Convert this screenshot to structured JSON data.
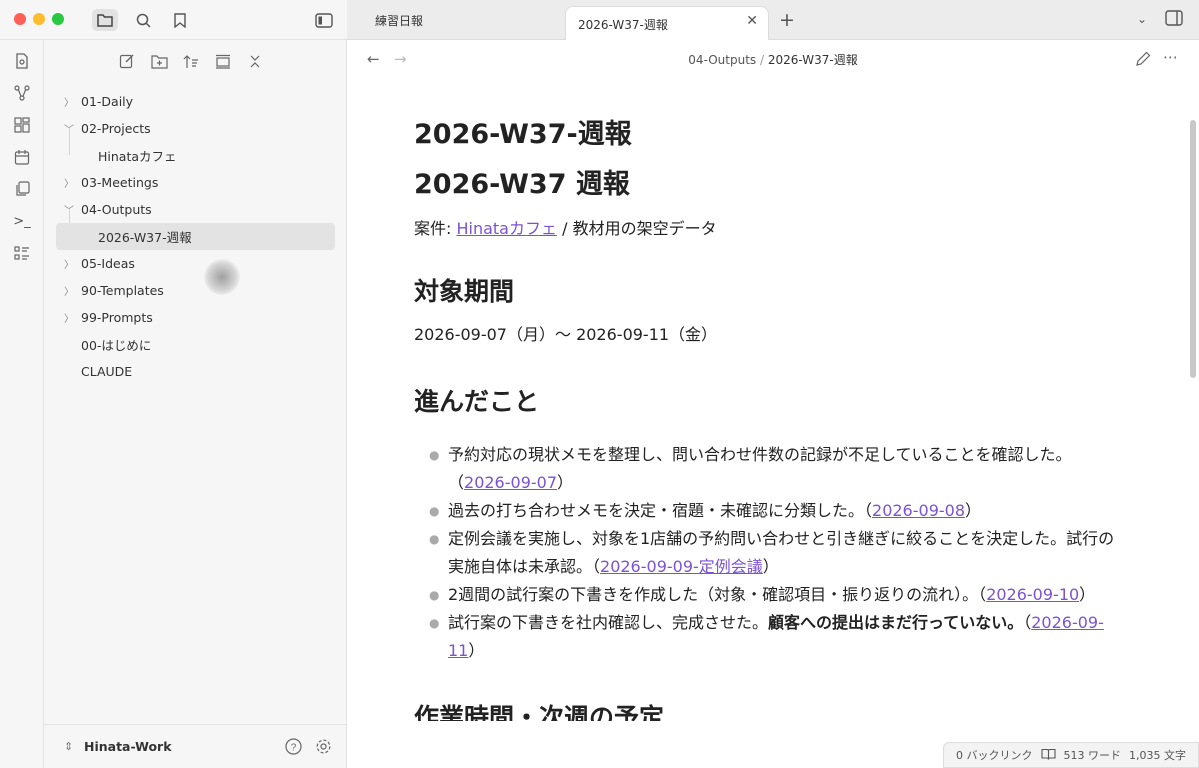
{
  "window": {
    "traffic_lights": [
      "#ff5f57",
      "#febc2e",
      "#28c840"
    ]
  },
  "tabs": [
    {
      "label": "練習日報",
      "active": false
    },
    {
      "label": "2026-W37-週報",
      "active": true
    }
  ],
  "sidebar": {
    "tree": [
      {
        "label": "01-Daily",
        "type": "folder",
        "expanded": false
      },
      {
        "label": "02-Projects",
        "type": "folder",
        "expanded": true
      },
      {
        "label": "Hinataカフェ",
        "type": "file",
        "child": true
      },
      {
        "label": "03-Meetings",
        "type": "folder",
        "expanded": false
      },
      {
        "label": "04-Outputs",
        "type": "folder",
        "expanded": true
      },
      {
        "label": "2026-W37-週報",
        "type": "file",
        "child": true,
        "selected": true
      },
      {
        "label": "05-Ideas",
        "type": "folder",
        "expanded": false
      },
      {
        "label": "90-Templates",
        "type": "folder",
        "expanded": false
      },
      {
        "label": "99-Prompts",
        "type": "folder",
        "expanded": false
      },
      {
        "label": "00-はじめに",
        "type": "file"
      },
      {
        "label": "CLAUDE",
        "type": "file"
      }
    ],
    "vault_name": "Hinata-Work"
  },
  "breadcrumb": {
    "folder": "04-Outputs",
    "separator": " / ",
    "file": "2026-W37-週報"
  },
  "doc": {
    "title": "2026-W37-週報",
    "h1": "2026-W37 週報",
    "project_prefix": "案件: ",
    "project_link": "Hinataカフェ",
    "project_suffix": " / 教材用の架空データ",
    "section1": "対象期間",
    "period": "2026-09-07（月）〜 2026-09-11（金）",
    "section2": "進んだこと",
    "bullets": [
      {
        "text": "予約対応の現状メモを整理し、問い合わせ件数の記録が不足していることを確認した。（",
        "link": "2026-09-07",
        "after": "）"
      },
      {
        "text": "過去の打ち合わせメモを決定・宿題・未確認に分類した。（",
        "link": "2026-09-08",
        "after": "）"
      },
      {
        "text": "定例会議を実施し、対象を1店舗の予約問い合わせと引き継ぎに絞ることを決定した。試行の実施自体は未承認。（",
        "link": "2026-09-09-定例会議",
        "after": "）"
      },
      {
        "text": "2週間の試行案の下書きを作成した（対象・確認項目・振り返りの流れ）。（",
        "link": "2026-09-10",
        "after": "）"
      },
      {
        "text": "試行案の下書きを社内確認し、完成させた。",
        "bold": "顧客への提出はまだ行っていない。",
        "text2": "（",
        "link": "2026-09-11",
        "after": "）"
      }
    ],
    "section3_partial": "作業時間・次週の予定"
  },
  "status": {
    "backlinks": "0 バックリンク",
    "words": "513 ワード",
    "chars": "1,035 文字"
  }
}
